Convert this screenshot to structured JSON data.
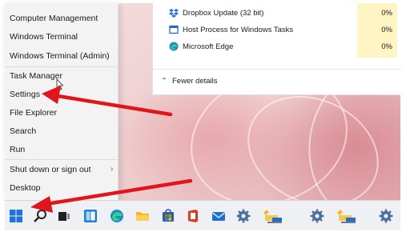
{
  "context_menu": {
    "items": [
      {
        "label": "Computer Management"
      },
      {
        "label": "Windows Terminal"
      },
      {
        "label": "Windows Terminal (Admin)"
      },
      {
        "label": "Task Manager"
      },
      {
        "label": "Settings"
      },
      {
        "label": "File Explorer"
      },
      {
        "label": "Search"
      },
      {
        "label": "Run"
      },
      {
        "label": "Shut down or sign out"
      },
      {
        "label": "Desktop"
      }
    ]
  },
  "task_manager": {
    "processes": [
      {
        "name": "Dropbox Update (32 bit)",
        "cpu": "0%",
        "icon": "dropbox-icon"
      },
      {
        "name": "Host Process for Windows Tasks",
        "cpu": "0%",
        "icon": "window-icon"
      },
      {
        "name": "Microsoft Edge",
        "cpu": "0%",
        "icon": "edge-icon"
      }
    ],
    "fewer_details_label": "Fewer details"
  },
  "taskbar": {
    "icons": [
      "start-icon",
      "search-icon",
      "task-view-icon",
      "widgets-icon",
      "edge-icon",
      "file-explorer-icon",
      "store-icon",
      "office-icon",
      "mail-icon",
      "settings-icon",
      "network-folder-icon",
      "settings-icon",
      "network-folder-icon",
      "settings-icon"
    ]
  },
  "colors": {
    "annotation_arrow": "#e0161b",
    "cpu_highlight": "#fff4c4",
    "menu_bg": "#f3f3f3"
  }
}
